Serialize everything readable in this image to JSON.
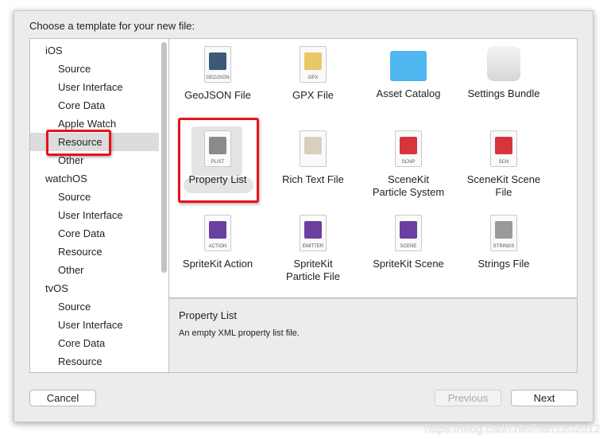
{
  "prompt": "Choose a template for your new file:",
  "sidebar": [
    {
      "label": "iOS",
      "type": "group"
    },
    {
      "label": "Source",
      "type": "child"
    },
    {
      "label": "User Interface",
      "type": "child"
    },
    {
      "label": "Core Data",
      "type": "child"
    },
    {
      "label": "Apple Watch",
      "type": "child"
    },
    {
      "label": "Resource",
      "type": "child",
      "selected": true
    },
    {
      "label": "Other",
      "type": "child"
    },
    {
      "label": "watchOS",
      "type": "group"
    },
    {
      "label": "Source",
      "type": "child"
    },
    {
      "label": "User Interface",
      "type": "child"
    },
    {
      "label": "Core Data",
      "type": "child"
    },
    {
      "label": "Resource",
      "type": "child"
    },
    {
      "label": "Other",
      "type": "child"
    },
    {
      "label": "tvOS",
      "type": "group"
    },
    {
      "label": "Source",
      "type": "child"
    },
    {
      "label": "User Interface",
      "type": "child"
    },
    {
      "label": "Core Data",
      "type": "child"
    },
    {
      "label": "Resource",
      "type": "child"
    }
  ],
  "templates": [
    {
      "label": "GeoJSON File",
      "tag": "GEOJSON",
      "icon": "geojson-file-icon",
      "color": "#3b5a7a"
    },
    {
      "label": "GPX File",
      "tag": "GPX",
      "icon": "gpx-file-icon",
      "color": "#e9c86a"
    },
    {
      "label": "Asset Catalog",
      "tag": "",
      "icon": "folder-icon",
      "color": "#4fb6ef"
    },
    {
      "label": "Settings Bundle",
      "tag": "",
      "icon": "lego-block-icon",
      "color": "#e6e6e6"
    },
    {
      "label": "Property List",
      "tag": "PLIST",
      "icon": "plist-file-icon",
      "color": "#8a8a8a",
      "selected": true
    },
    {
      "label": "Rich Text File",
      "tag": "",
      "icon": "rich-text-file-icon",
      "color": "#d9cfc0"
    },
    {
      "label": "SceneKit\nParticle System",
      "tag": "SCNP",
      "icon": "scenekit-particle-icon",
      "color": "#d8343e"
    },
    {
      "label": "SceneKit Scene\nFile",
      "tag": "SCN",
      "icon": "scenekit-scene-icon",
      "color": "#d8343e"
    },
    {
      "label": "SpriteKit Action",
      "tag": "ACTION",
      "icon": "spritekit-action-icon",
      "color": "#6b3fa0"
    },
    {
      "label": "SpriteKit\nParticle File",
      "tag": "EMITTER",
      "icon": "spritekit-emitter-icon",
      "color": "#6b3fa0"
    },
    {
      "label": "SpriteKit Scene",
      "tag": "SCENE",
      "icon": "spritekit-scene-icon",
      "color": "#6b3fa0"
    },
    {
      "label": "Strings File",
      "tag": "STRINGS",
      "icon": "strings-file-icon",
      "color": "#9a9a9a"
    }
  ],
  "description": {
    "title": "Property List",
    "text": "An empty XML property list file."
  },
  "buttons": {
    "cancel": "Cancel",
    "previous": "Previous",
    "next": "Next"
  },
  "watermark": "https://blog.csdn.net/han1202012",
  "colors": {
    "highlight": "#e8111a"
  }
}
